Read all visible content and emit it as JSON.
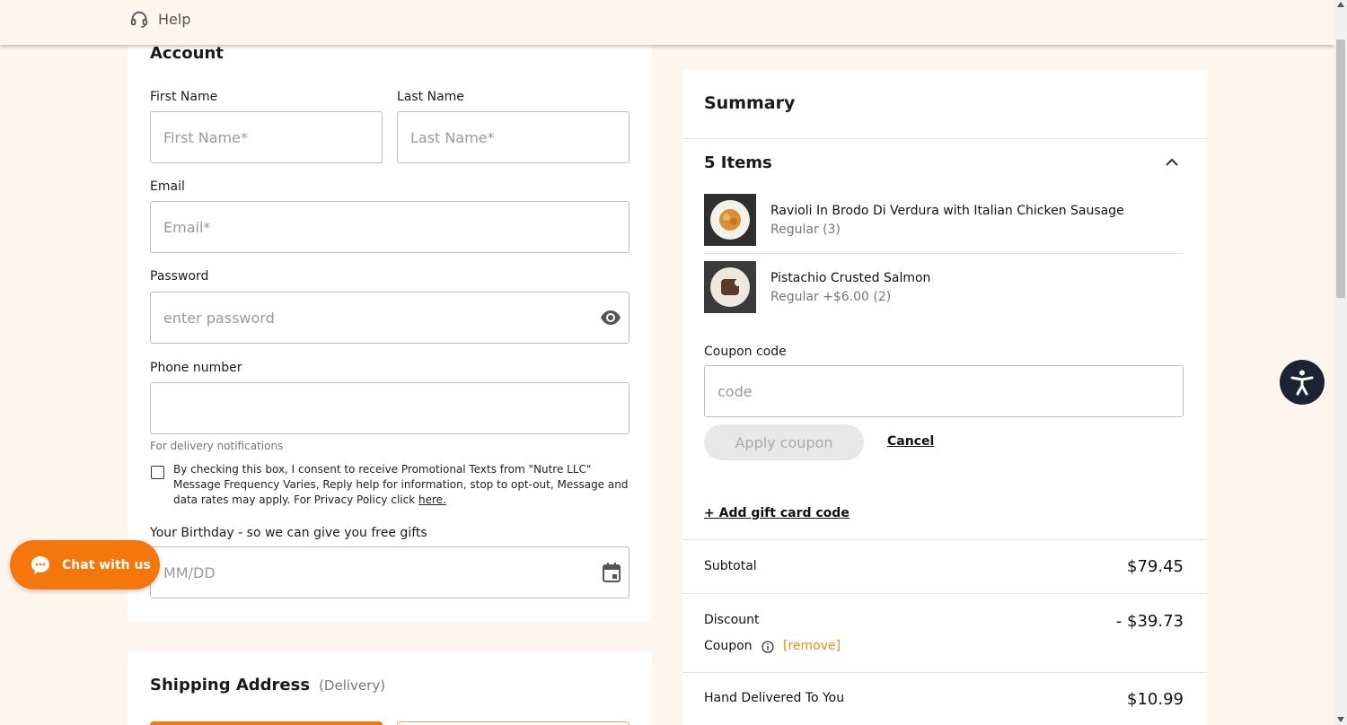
{
  "header": {
    "help_label": "Help"
  },
  "account": {
    "title": "Account",
    "first_name_label": "First Name",
    "first_name_placeholder": "First Name*",
    "last_name_label": "Last Name",
    "last_name_placeholder": "Last Name*",
    "email_label": "Email",
    "email_placeholder": "Email*",
    "password_label": "Password",
    "password_placeholder": "enter password",
    "phone_label": "Phone number",
    "phone_value": "",
    "phone_note": "For delivery notifications",
    "consent_text": "By checking this box, I consent to receive Promotional Texts from \"Nutre LLC\" Message Frequency Varies, Reply help for information, stop to opt-out, Message and data rates may apply. For Privacy Policy click",
    "consent_link": "here.",
    "birthday_label": "Your Birthday - so we can give you free gifts",
    "birthday_placeholder": "MM/DD"
  },
  "shipping": {
    "title": "Shipping Address",
    "subtitle": "(Delivery)"
  },
  "summary": {
    "title": "Summary",
    "items_title": "5 Items",
    "items": [
      {
        "name": "Ravioli In Brodo Di Verdura with Italian Chicken Sausage",
        "detail": "Regular (3)"
      },
      {
        "name": "Pistachio Crusted Salmon",
        "detail": "Regular +$6.00 (2)"
      }
    ],
    "coupon_label": "Coupon code",
    "coupon_placeholder": "code",
    "apply_label": "Apply coupon",
    "cancel_label": "Cancel",
    "gift_label": "+ Add gift card code",
    "subtotal_label": "Subtotal",
    "subtotal_value": "$79.45",
    "discount_label": "Discount",
    "discount_value": "- $39.73",
    "coupon_row_label": "Coupon",
    "remove_label": "[remove]",
    "delivery_label": "Hand Delivered To You",
    "delivery_value": "$10.99"
  },
  "chat": {
    "label": "Chat with us"
  },
  "colors": {
    "accent": "#f5760a",
    "background": "#fdf6ee",
    "link_orange": "#e88a1a",
    "a11y": "#1c2333"
  },
  "icons": [
    "headset-icon",
    "eye-icon",
    "calendar-icon",
    "chevron-up-icon",
    "info-icon",
    "accessibility-icon",
    "chat-bubble-icon"
  ]
}
